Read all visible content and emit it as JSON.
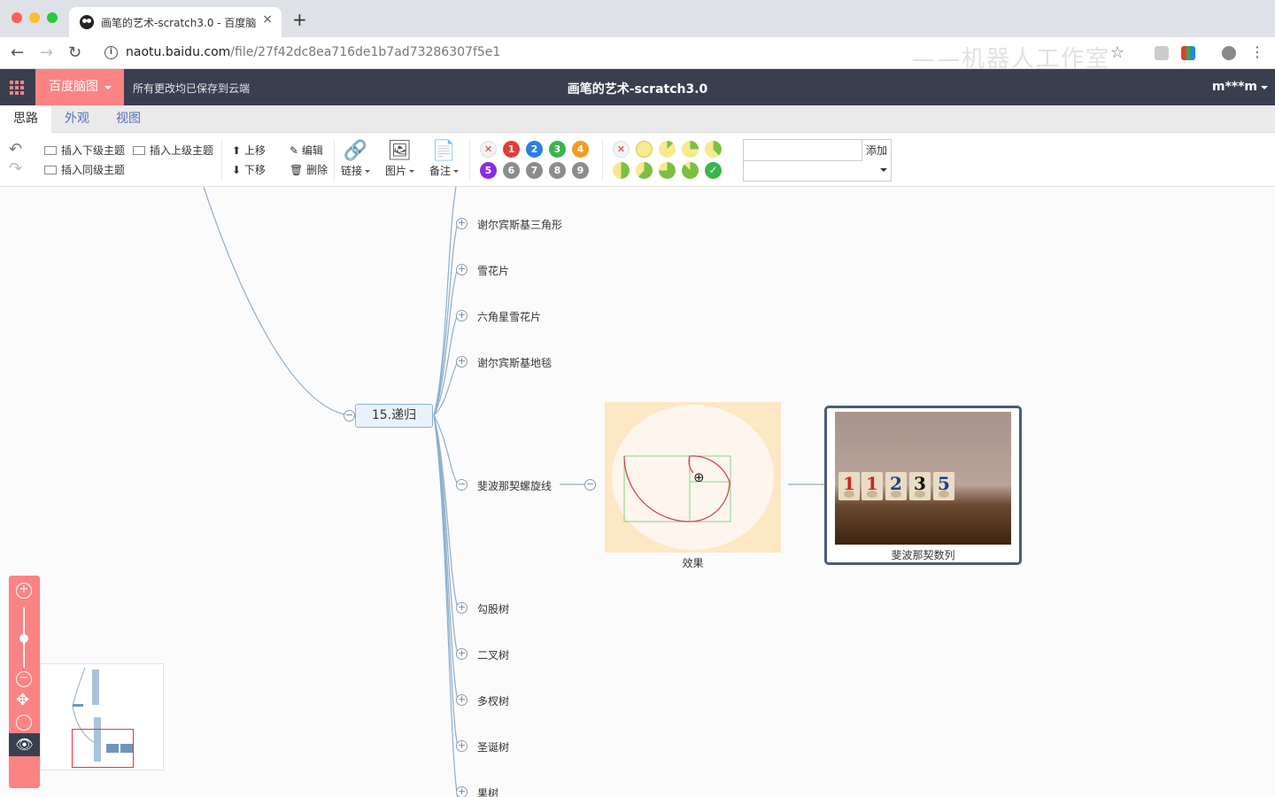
{
  "browser": {
    "tab_title": "画笔的艺术-scratch3.0 - 百度脑图",
    "tab_close": "×",
    "new_tab": "+",
    "url_host": "naotu.baidu.com",
    "url_path": "/file/27f42dc8ea716de1b7ad73286307f5e1",
    "watermark": "——机器人工作室"
  },
  "app": {
    "brand": "百度脑图",
    "save_status": "所有更改均已保存到云端",
    "doc_title": "画笔的艺术-scratch3.0",
    "user": "m***m"
  },
  "tabs": [
    "思路",
    "外观",
    "视图"
  ],
  "toolbar": {
    "insert_child": "插入下级主题",
    "insert_parent": "插入上级主题",
    "insert_sibling": "插入同级主题",
    "move_up": "上移",
    "move_down": "下移",
    "edit": "编辑",
    "delete": "删除",
    "link": "链接",
    "image": "图片",
    "note": "备注",
    "priority_row1": [
      "1",
      "2",
      "3",
      "4"
    ],
    "priority_row2": [
      "5",
      "6",
      "7",
      "8",
      "9"
    ],
    "resource_add": "添加"
  },
  "mindmap": {
    "main_topic": "15.递归",
    "upper_topics": [
      "谢尔宾斯基三角形",
      "雪花片",
      "六角星雪花片",
      "谢尔宾斯基地毯"
    ],
    "fib_topic": "斐波那契螺旋线",
    "image_caption": "效果",
    "photo_caption": "斐波那契数列",
    "photo_digits": [
      "1",
      "1",
      "2",
      "3",
      "5"
    ],
    "lower_topics": [
      "勾股树",
      "二叉树",
      "多杈树",
      "圣诞树",
      "果树"
    ]
  },
  "colors": {
    "accent": "#fc8383",
    "header_bg": "#393f4f",
    "link_blue": "#546fc1",
    "branch_line": "#8eaecb"
  }
}
